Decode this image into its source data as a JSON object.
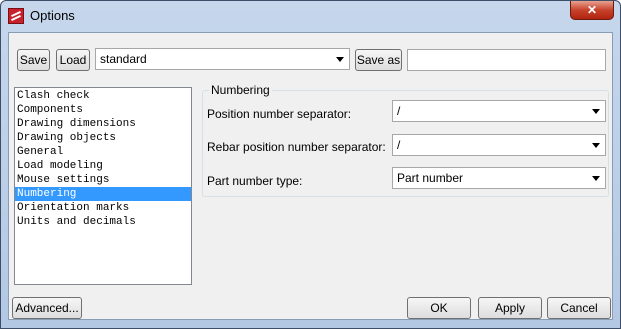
{
  "window": {
    "title": "Options",
    "close_label": "✕"
  },
  "toolbar": {
    "save_label": "Save",
    "load_label": "Load",
    "profile_value": "standard",
    "save_as_label": "Save as",
    "save_as_value": ""
  },
  "categories": [
    "Clash check",
    "Components",
    "Drawing dimensions",
    "Drawing objects",
    "General",
    "Load modeling",
    "Mouse settings",
    "Numbering",
    "Orientation marks",
    "Units and decimals"
  ],
  "selected_category": "Numbering",
  "numbering": {
    "group_title": "Numbering",
    "position_separator_label": "Position number separator:",
    "position_separator_value": "/",
    "rebar_separator_label": "Rebar position number separator:",
    "rebar_separator_value": "/",
    "part_number_type_label": "Part number type:",
    "part_number_type_value": "Part number"
  },
  "footer": {
    "advanced_label": "Advanced...",
    "ok_label": "OK",
    "apply_label": "Apply",
    "cancel_label": "Cancel"
  },
  "icons": {
    "app": "app-logo-icon",
    "close": "close-icon",
    "dropdown": "chevron-down-icon"
  },
  "colors": {
    "selection": "#3399ff",
    "close_button": "#c7432c",
    "frame": "#b3c8e3"
  }
}
